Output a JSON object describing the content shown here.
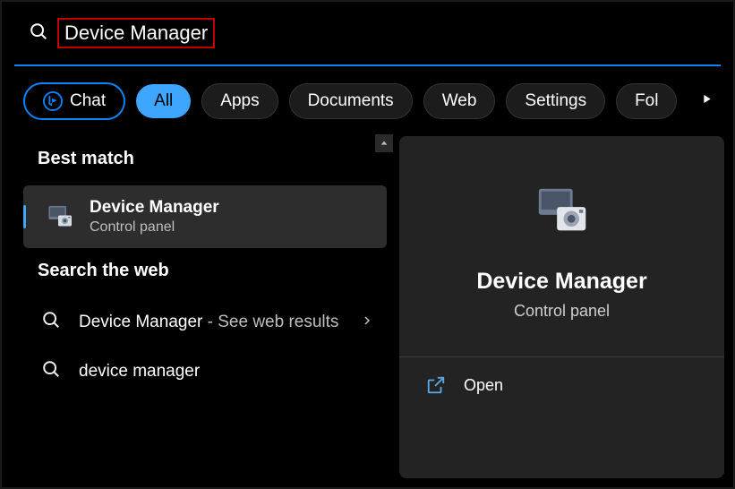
{
  "search": {
    "value": "Device Manager"
  },
  "filters": {
    "chat": "Chat",
    "all": "All",
    "apps": "Apps",
    "documents": "Documents",
    "web": "Web",
    "settings": "Settings",
    "folders": "Fol"
  },
  "sections": {
    "best_match": "Best match",
    "search_web": "Search the web"
  },
  "best_match_item": {
    "title": "Device Manager",
    "subtitle": "Control panel"
  },
  "web_results": [
    {
      "title": "Device Manager",
      "suffix": " - See web results"
    },
    {
      "title": "device manager",
      "suffix": ""
    }
  ],
  "details": {
    "title": "Device Manager",
    "subtitle": "Control panel",
    "action_open": "Open"
  }
}
